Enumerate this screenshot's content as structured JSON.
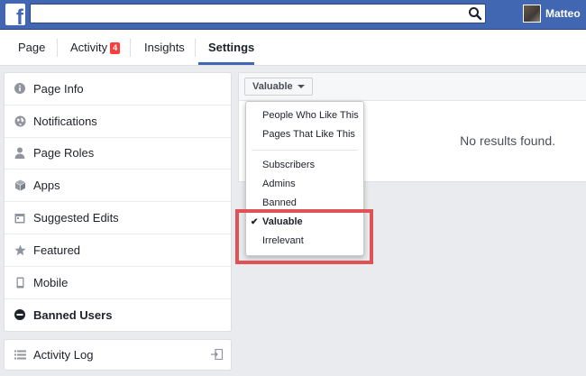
{
  "topbar": {
    "logo": "f",
    "search_placeholder": "",
    "profile_name": "Matteo",
    "brand_color": "#4267b2"
  },
  "tabs": {
    "page": "Page",
    "activity": "Activity",
    "activity_badge": "4",
    "insights": "Insights",
    "settings": "Settings"
  },
  "sidebar": {
    "items": [
      {
        "label": "Page Info",
        "icon": "info-icon"
      },
      {
        "label": "Notifications",
        "icon": "globe-icon"
      },
      {
        "label": "Page Roles",
        "icon": "person-icon"
      },
      {
        "label": "Apps",
        "icon": "cube-icon"
      },
      {
        "label": "Suggested Edits",
        "icon": "calendar-icon"
      },
      {
        "label": "Featured",
        "icon": "star-icon"
      },
      {
        "label": "Mobile",
        "icon": "phone-icon"
      },
      {
        "label": "Banned Users",
        "icon": "ban-icon",
        "active": true
      }
    ],
    "activity_log": "Activity Log"
  },
  "main": {
    "filter_label": "Valuable",
    "no_results": "No results found."
  },
  "menu": {
    "group1": [
      "People Who Like This",
      "Pages That Like This"
    ],
    "group2": [
      "Subscribers",
      "Admins",
      "Banned",
      "Valuable",
      "Irrelevant"
    ],
    "checked": "Valuable",
    "check_mark": "✔"
  },
  "colors": {
    "highlight": "#e05256",
    "badge": "#fa3e3e"
  }
}
